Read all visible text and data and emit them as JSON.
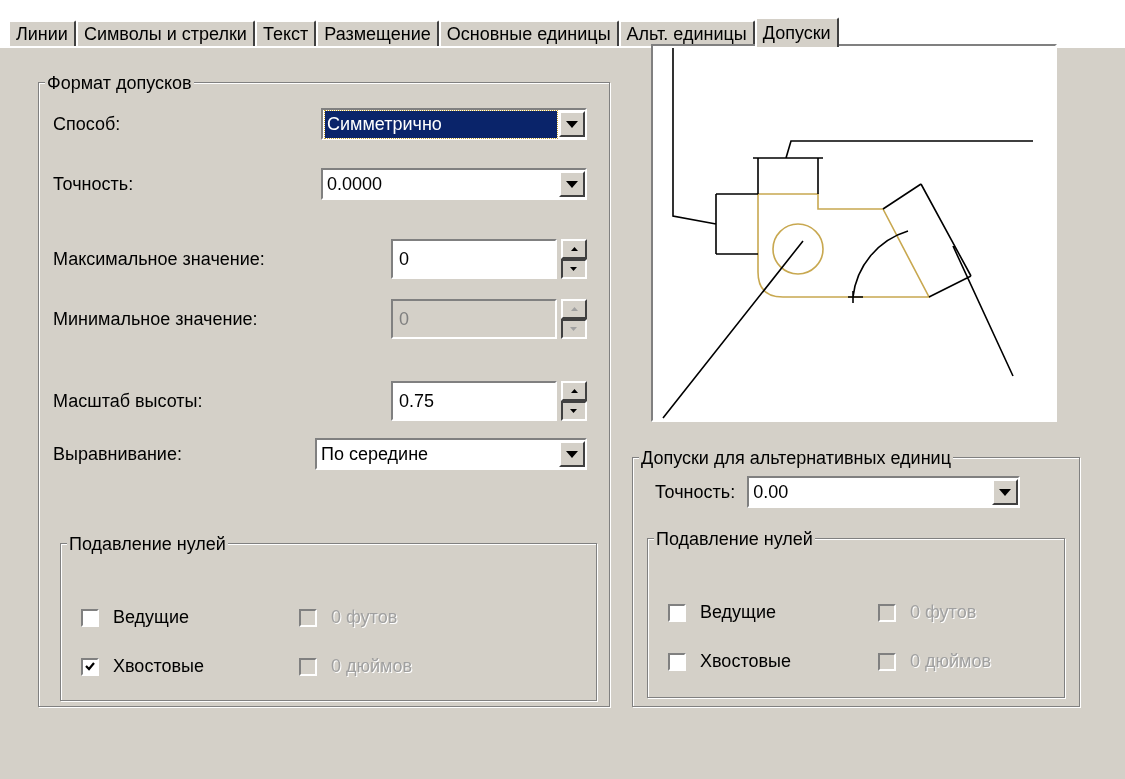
{
  "tabs": [
    {
      "label": "Линии",
      "selected": false
    },
    {
      "label": "Символы и стрелки",
      "selected": false
    },
    {
      "label": "Текст",
      "selected": false
    },
    {
      "label": "Размещение",
      "selected": false
    },
    {
      "label": "Основные единицы",
      "selected": false
    },
    {
      "label": "Альт. единицы",
      "selected": false
    },
    {
      "label": "Допуски",
      "selected": true
    }
  ],
  "format_group": {
    "title": "Формат допусков",
    "fields": [
      {
        "kind": "combo",
        "label": "Способ:",
        "value": "Симметрично",
        "focused": true,
        "disabled": false
      },
      {
        "kind": "combo",
        "label": "Точность:",
        "value": "0.0000",
        "focused": false,
        "disabled": false
      },
      {
        "kind": "spin",
        "label": "Максимальное значение:",
        "value": "0",
        "focused": false,
        "disabled": false
      },
      {
        "kind": "spin",
        "label": "Минимальное значение:",
        "value": "0",
        "focused": false,
        "disabled": true
      },
      {
        "kind": "spin",
        "label": "Масштаб высоты:",
        "value": "0.75",
        "focused": false,
        "disabled": false
      },
      {
        "kind": "combo",
        "label": "Выравнивание:",
        "value": "По середине",
        "focused": false,
        "disabled": false
      }
    ],
    "zero_suppression": {
      "title": "Подавление нулей",
      "options": [
        {
          "label": "Ведущие",
          "checked": false,
          "disabled": false
        },
        {
          "label": "0 футов",
          "checked": false,
          "disabled": true
        },
        {
          "label": "Хвостовые",
          "checked": true,
          "disabled": false
        },
        {
          "label": "0 дюймов",
          "checked": false,
          "disabled": true
        }
      ]
    }
  },
  "alt_group": {
    "title": "Допуски для альтернативных единиц",
    "precision": {
      "label": "Точность:",
      "value": "0.00"
    },
    "zero_suppression": {
      "title": "Подавление нулей",
      "options": [
        {
          "label": "Ведущие",
          "checked": false,
          "disabled": false
        },
        {
          "label": "0 футов",
          "checked": false,
          "disabled": true
        },
        {
          "label": "Хвостовые",
          "checked": false,
          "disabled": false
        },
        {
          "label": "0 дюймов",
          "checked": false,
          "disabled": true
        }
      ]
    }
  }
}
